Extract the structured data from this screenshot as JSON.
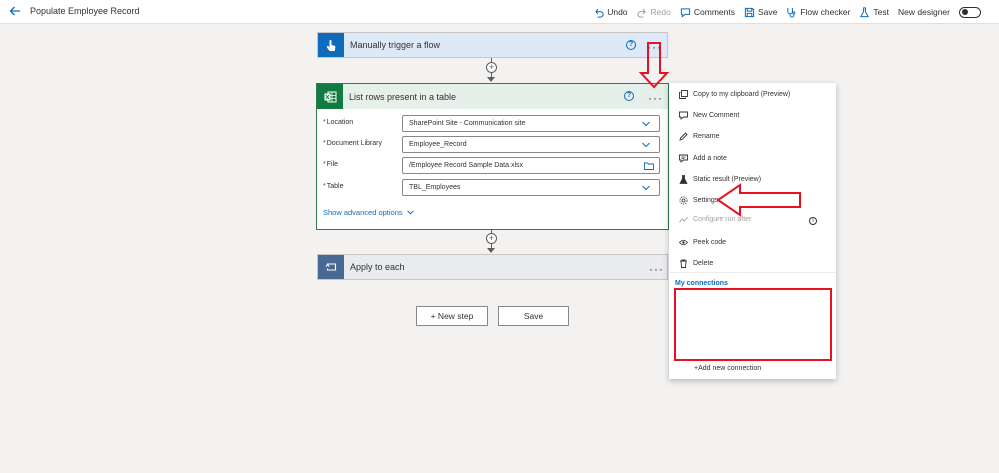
{
  "header": {
    "page_title": "Populate Employee Record",
    "toolbar": {
      "undo": "Undo",
      "redo": "Redo",
      "comments": "Comments",
      "save": "Save",
      "flow_checker": "Flow checker",
      "test": "Test",
      "new_designer": "New designer"
    }
  },
  "trigger_card": {
    "title": "Manually trigger a flow",
    "accent": "#0f6cbd",
    "header_bg": "#dde9f7"
  },
  "list_rows_card": {
    "title": "List rows present in a table",
    "accent": "#107c41",
    "header_bg": "#e6f0ea",
    "fields": [
      {
        "label": "Location",
        "value": "SharePoint Site - Communication site"
      },
      {
        "label": "Document Library",
        "value": "Employee_Record"
      },
      {
        "label": "File",
        "value": "/Employee Record Sample Data.xlsx"
      },
      {
        "label": "Table",
        "value": "TBL_Employees"
      }
    ],
    "advanced_link": "Show advanced options"
  },
  "apply_card": {
    "title": "Apply to each",
    "accent": "#486991",
    "header_bg": "#e9ebef"
  },
  "buttons": {
    "new_step": "+ New step",
    "save": "Save"
  },
  "context_menu": {
    "items": [
      {
        "label": "Copy to my clipboard (Preview)",
        "icon": "copy-icon"
      },
      {
        "label": "New Comment",
        "icon": "comment-icon"
      },
      {
        "label": "Rename",
        "icon": "pencil-icon"
      },
      {
        "label": "Add a note",
        "icon": "note-icon"
      },
      {
        "label": "Static result (Preview)",
        "icon": "flask-icon"
      },
      {
        "label": "Settings",
        "icon": "gear-icon"
      },
      {
        "label": "Configure run after",
        "icon": "run-after-icon",
        "disabled": true
      },
      {
        "label": "Peek code",
        "icon": "eye-icon"
      },
      {
        "label": "Delete",
        "icon": "trash-icon"
      }
    ],
    "connections_header": "My connections",
    "add_connection": "+Add new connection"
  },
  "annotation_color": "#e81123"
}
